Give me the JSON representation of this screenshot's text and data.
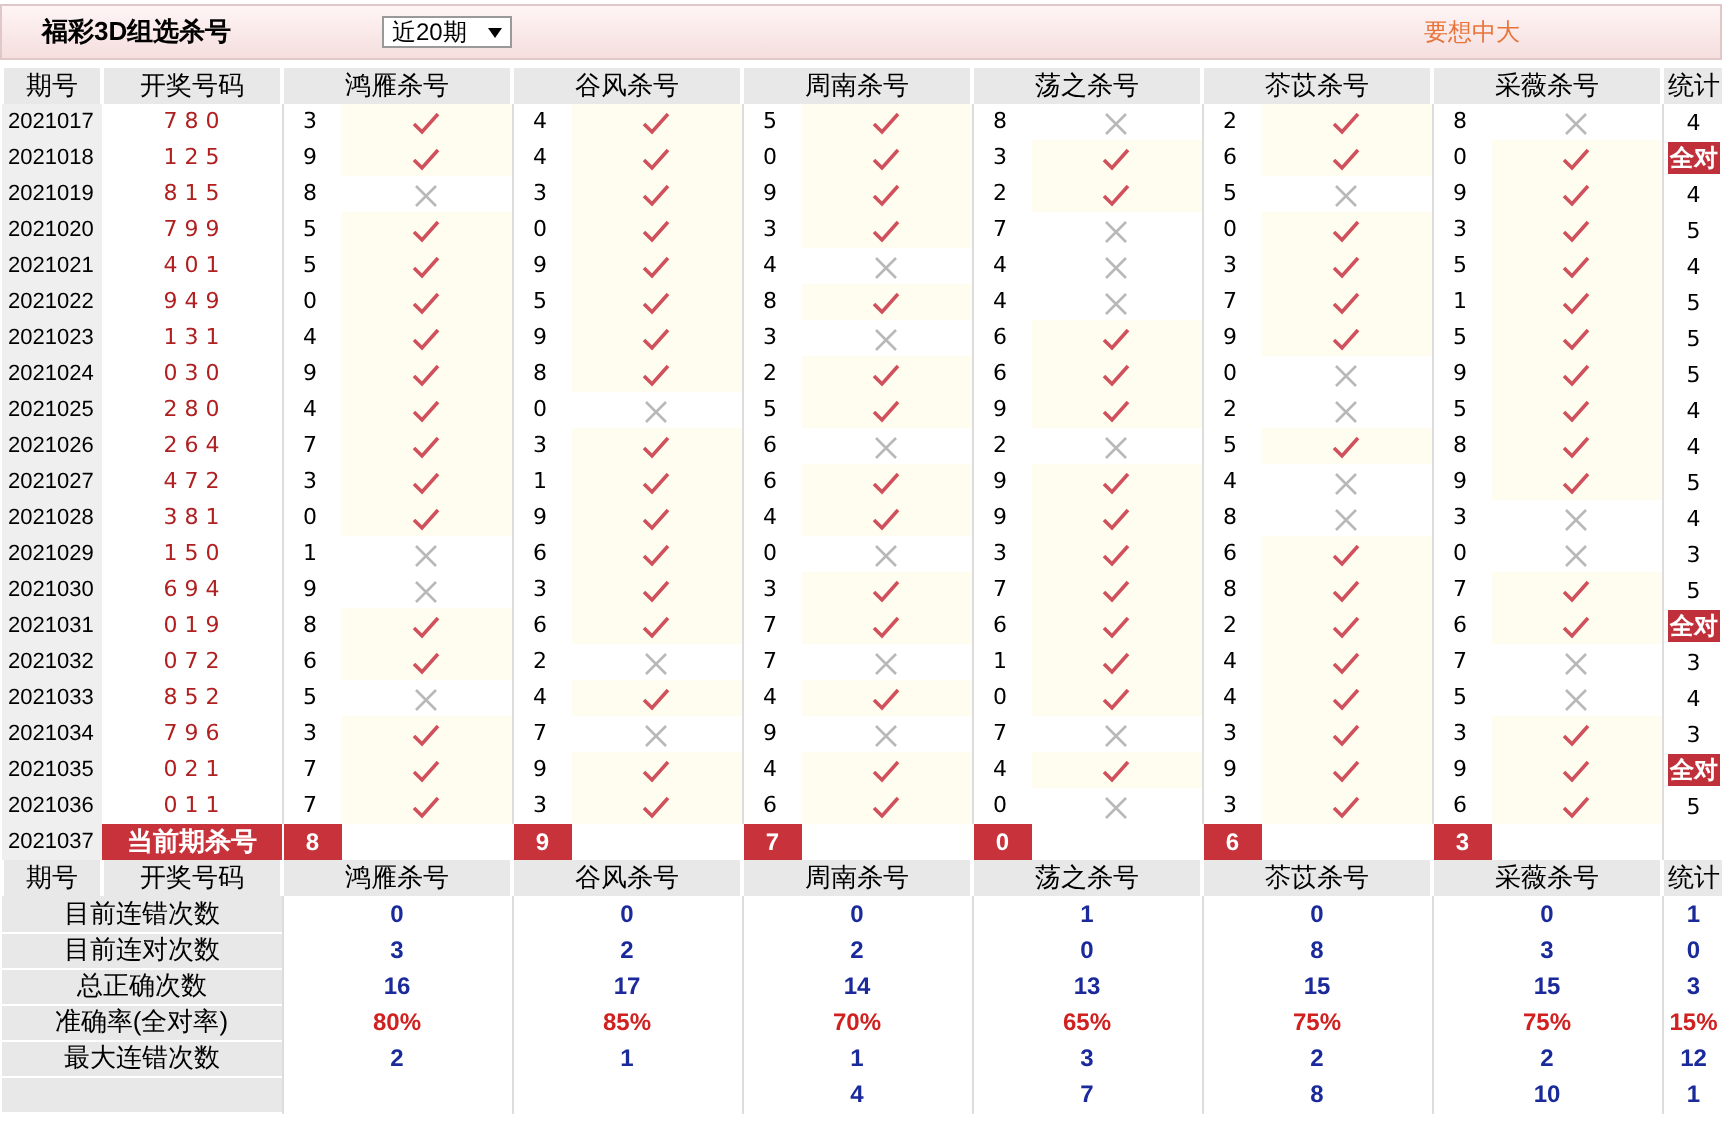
{
  "title": "福彩3D组选杀号",
  "range_select": {
    "value": "近20期"
  },
  "promo": "要想中大",
  "columns": [
    "期号",
    "开奖号码",
    "鸿雁杀号",
    "谷风杀号",
    "周南杀号",
    "荡之杀号",
    "苶苡杀号",
    "采薇杀号",
    "统计"
  ],
  "rows": [
    {
      "period": "2021017",
      "draw": "7 8 0",
      "kills": [
        {
          "num": "3",
          "hit": true
        },
        {
          "num": "4",
          "hit": true
        },
        {
          "num": "5",
          "hit": true
        },
        {
          "num": "8",
          "hit": false
        },
        {
          "num": "2",
          "hit": true
        },
        {
          "num": "8",
          "hit": false
        }
      ],
      "total": "4",
      "all_right": false
    },
    {
      "period": "2021018",
      "draw": "1 2 5",
      "kills": [
        {
          "num": "9",
          "hit": true
        },
        {
          "num": "4",
          "hit": true
        },
        {
          "num": "0",
          "hit": true
        },
        {
          "num": "3",
          "hit": true
        },
        {
          "num": "6",
          "hit": true
        },
        {
          "num": "0",
          "hit": true
        }
      ],
      "total": "全对",
      "all_right": true
    },
    {
      "period": "2021019",
      "draw": "8 1 5",
      "kills": [
        {
          "num": "8",
          "hit": false
        },
        {
          "num": "3",
          "hit": true
        },
        {
          "num": "9",
          "hit": true
        },
        {
          "num": "2",
          "hit": true
        },
        {
          "num": "5",
          "hit": false
        },
        {
          "num": "9",
          "hit": true
        }
      ],
      "total": "4",
      "all_right": false
    },
    {
      "period": "2021020",
      "draw": "7 9 9",
      "kills": [
        {
          "num": "5",
          "hit": true
        },
        {
          "num": "0",
          "hit": true
        },
        {
          "num": "3",
          "hit": true
        },
        {
          "num": "7",
          "hit": false
        },
        {
          "num": "0",
          "hit": true
        },
        {
          "num": "3",
          "hit": true
        }
      ],
      "total": "5",
      "all_right": false
    },
    {
      "period": "2021021",
      "draw": "4 0 1",
      "kills": [
        {
          "num": "5",
          "hit": true
        },
        {
          "num": "9",
          "hit": true
        },
        {
          "num": "4",
          "hit": false
        },
        {
          "num": "4",
          "hit": false
        },
        {
          "num": "3",
          "hit": true
        },
        {
          "num": "5",
          "hit": true
        }
      ],
      "total": "4",
      "all_right": false
    },
    {
      "period": "2021022",
      "draw": "9 4 9",
      "kills": [
        {
          "num": "0",
          "hit": true
        },
        {
          "num": "5",
          "hit": true
        },
        {
          "num": "8",
          "hit": true
        },
        {
          "num": "4",
          "hit": false
        },
        {
          "num": "7",
          "hit": true
        },
        {
          "num": "1",
          "hit": true
        }
      ],
      "total": "5",
      "all_right": false
    },
    {
      "period": "2021023",
      "draw": "1 3 1",
      "kills": [
        {
          "num": "4",
          "hit": true
        },
        {
          "num": "9",
          "hit": true
        },
        {
          "num": "3",
          "hit": false
        },
        {
          "num": "6",
          "hit": true
        },
        {
          "num": "9",
          "hit": true
        },
        {
          "num": "5",
          "hit": true
        }
      ],
      "total": "5",
      "all_right": false
    },
    {
      "period": "2021024",
      "draw": "0 3 0",
      "kills": [
        {
          "num": "9",
          "hit": true
        },
        {
          "num": "8",
          "hit": true
        },
        {
          "num": "2",
          "hit": true
        },
        {
          "num": "6",
          "hit": true
        },
        {
          "num": "0",
          "hit": false
        },
        {
          "num": "9",
          "hit": true
        }
      ],
      "total": "5",
      "all_right": false
    },
    {
      "period": "2021025",
      "draw": "2 8 0",
      "kills": [
        {
          "num": "4",
          "hit": true
        },
        {
          "num": "0",
          "hit": false
        },
        {
          "num": "5",
          "hit": true
        },
        {
          "num": "9",
          "hit": true
        },
        {
          "num": "2",
          "hit": false
        },
        {
          "num": "5",
          "hit": true
        }
      ],
      "total": "4",
      "all_right": false
    },
    {
      "period": "2021026",
      "draw": "2 6 4",
      "kills": [
        {
          "num": "7",
          "hit": true
        },
        {
          "num": "3",
          "hit": true
        },
        {
          "num": "6",
          "hit": false
        },
        {
          "num": "2",
          "hit": false
        },
        {
          "num": "5",
          "hit": true
        },
        {
          "num": "8",
          "hit": true
        }
      ],
      "total": "4",
      "all_right": false
    },
    {
      "period": "2021027",
      "draw": "4 7 2",
      "kills": [
        {
          "num": "3",
          "hit": true
        },
        {
          "num": "1",
          "hit": true
        },
        {
          "num": "6",
          "hit": true
        },
        {
          "num": "9",
          "hit": true
        },
        {
          "num": "4",
          "hit": false
        },
        {
          "num": "9",
          "hit": true
        }
      ],
      "total": "5",
      "all_right": false
    },
    {
      "period": "2021028",
      "draw": "3 8 1",
      "kills": [
        {
          "num": "0",
          "hit": true
        },
        {
          "num": "9",
          "hit": true
        },
        {
          "num": "4",
          "hit": true
        },
        {
          "num": "9",
          "hit": true
        },
        {
          "num": "8",
          "hit": false
        },
        {
          "num": "3",
          "hit": false
        }
      ],
      "total": "4",
      "all_right": false
    },
    {
      "period": "2021029",
      "draw": "1 5 0",
      "kills": [
        {
          "num": "1",
          "hit": false
        },
        {
          "num": "6",
          "hit": true
        },
        {
          "num": "0",
          "hit": false
        },
        {
          "num": "3",
          "hit": true
        },
        {
          "num": "6",
          "hit": true
        },
        {
          "num": "0",
          "hit": false
        }
      ],
      "total": "3",
      "all_right": false
    },
    {
      "period": "2021030",
      "draw": "6 9 4",
      "kills": [
        {
          "num": "9",
          "hit": false
        },
        {
          "num": "3",
          "hit": true
        },
        {
          "num": "3",
          "hit": true
        },
        {
          "num": "7",
          "hit": true
        },
        {
          "num": "8",
          "hit": true
        },
        {
          "num": "7",
          "hit": true
        }
      ],
      "total": "5",
      "all_right": false
    },
    {
      "period": "2021031",
      "draw": "0 1 9",
      "kills": [
        {
          "num": "8",
          "hit": true
        },
        {
          "num": "6",
          "hit": true
        },
        {
          "num": "7",
          "hit": true
        },
        {
          "num": "6",
          "hit": true
        },
        {
          "num": "2",
          "hit": true
        },
        {
          "num": "6",
          "hit": true
        }
      ],
      "total": "全对",
      "all_right": true
    },
    {
      "period": "2021032",
      "draw": "0 7 2",
      "kills": [
        {
          "num": "6",
          "hit": true
        },
        {
          "num": "2",
          "hit": false
        },
        {
          "num": "7",
          "hit": false
        },
        {
          "num": "1",
          "hit": true
        },
        {
          "num": "4",
          "hit": true
        },
        {
          "num": "7",
          "hit": false
        }
      ],
      "total": "3",
      "all_right": false
    },
    {
      "period": "2021033",
      "draw": "8 5 2",
      "kills": [
        {
          "num": "5",
          "hit": false
        },
        {
          "num": "4",
          "hit": true
        },
        {
          "num": "4",
          "hit": true
        },
        {
          "num": "0",
          "hit": true
        },
        {
          "num": "4",
          "hit": true
        },
        {
          "num": "5",
          "hit": false
        }
      ],
      "total": "4",
      "all_right": false
    },
    {
      "period": "2021034",
      "draw": "7 9 6",
      "kills": [
        {
          "num": "3",
          "hit": true
        },
        {
          "num": "7",
          "hit": false
        },
        {
          "num": "9",
          "hit": false
        },
        {
          "num": "7",
          "hit": false
        },
        {
          "num": "3",
          "hit": true
        },
        {
          "num": "3",
          "hit": true
        }
      ],
      "total": "3",
      "all_right": false
    },
    {
      "period": "2021035",
      "draw": "0 2 1",
      "kills": [
        {
          "num": "7",
          "hit": true
        },
        {
          "num": "9",
          "hit": true
        },
        {
          "num": "4",
          "hit": true
        },
        {
          "num": "4",
          "hit": true
        },
        {
          "num": "9",
          "hit": true
        },
        {
          "num": "9",
          "hit": true
        }
      ],
      "total": "全对",
      "all_right": true
    },
    {
      "period": "2021036",
      "draw": "0 1 1",
      "kills": [
        {
          "num": "7",
          "hit": true
        },
        {
          "num": "3",
          "hit": true
        },
        {
          "num": "6",
          "hit": true
        },
        {
          "num": "0",
          "hit": false
        },
        {
          "num": "3",
          "hit": true
        },
        {
          "num": "6",
          "hit": true
        }
      ],
      "total": "5",
      "all_right": false
    }
  ],
  "current": {
    "period": "2021037",
    "label": "当前期杀号",
    "kills": [
      "8",
      "9",
      "7",
      "0",
      "6",
      "3"
    ]
  },
  "stats": {
    "header": {
      "period": "期号",
      "draw": "开奖号码",
      "sources": [
        "鸿雁杀号",
        "谷风杀号",
        "周南杀号",
        "荡之杀号",
        "苶苡杀号",
        "采薇杀号"
      ],
      "total": "统计"
    },
    "rows": [
      {
        "label": "目前连错次数",
        "kind": "count",
        "cells": [
          {
            "value": "0"
          },
          {
            "value": "0"
          },
          {
            "value": "0"
          },
          {
            "value": "1"
          },
          {
            "value": "0"
          },
          {
            "value": "0"
          }
        ],
        "total": "1"
      },
      {
        "label": "目前连对次数",
        "kind": "count",
        "cells": [
          {
            "value": "3"
          },
          {
            "value": "2"
          },
          {
            "value": "2"
          },
          {
            "value": "0"
          },
          {
            "value": "8"
          },
          {
            "value": "3"
          }
        ],
        "total": "0"
      },
      {
        "label": "总正确次数",
        "kind": "count",
        "cells": [
          {
            "value": "16"
          },
          {
            "value": "17"
          },
          {
            "value": "14"
          },
          {
            "value": "13"
          },
          {
            "value": "15"
          },
          {
            "value": "15"
          }
        ],
        "total": "3"
      },
      {
        "label": "准确率(全对率)",
        "kind": "rate",
        "cells": [
          {
            "value": "80%"
          },
          {
            "value": "85%"
          },
          {
            "value": "70%"
          },
          {
            "value": "65%"
          },
          {
            "value": "75%"
          },
          {
            "value": "75%"
          }
        ],
        "total": "15%"
      },
      {
        "label": "最大连错次数",
        "kind": "count",
        "cells": [
          {
            "value": "2"
          },
          {
            "value": "1"
          },
          {
            "value": "1"
          },
          {
            "value": "3"
          },
          {
            "value": "2"
          },
          {
            "value": "2"
          }
        ],
        "total": "12"
      },
      {
        "kind": "count",
        "cells": [
          {},
          {},
          {
            "value": "4"
          },
          {
            "value": "7"
          },
          {
            "value": "8"
          },
          {
            "value": "10"
          }
        ],
        "total": "1"
      }
    ]
  }
}
